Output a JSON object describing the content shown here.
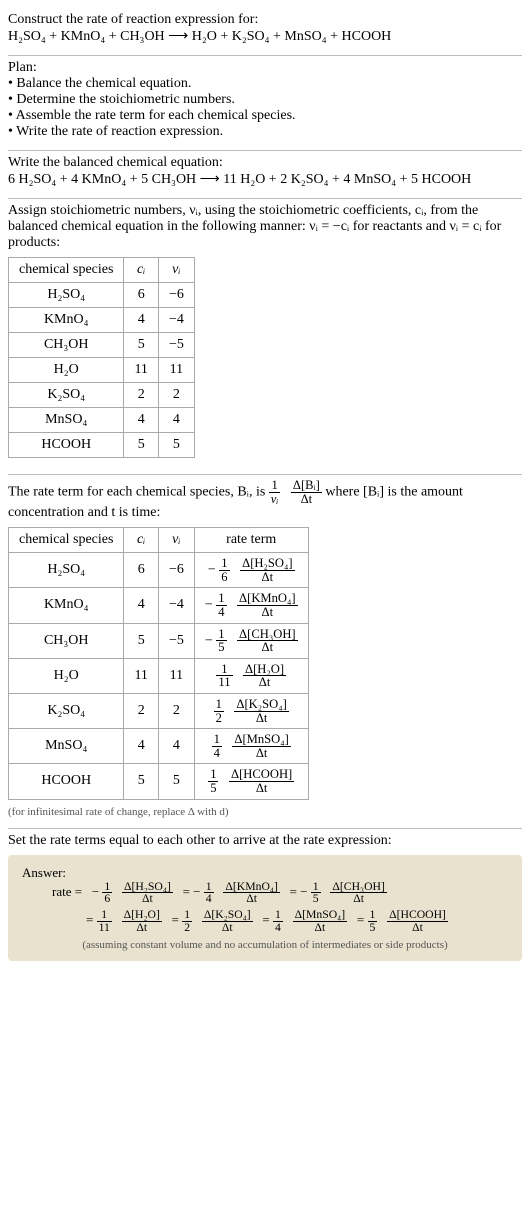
{
  "prompt_title": "Construct the rate of reaction expression for:",
  "main_eq": "H₂SO₄ + KMnO₄ + CH₃OH ⟶ H₂O + K₂SO₄ + MnSO₄ + HCOOH",
  "plan_title": "Plan:",
  "plan_items": [
    "Balance the chemical equation.",
    "Determine the stoichiometric numbers.",
    "Assemble the rate term for each chemical species.",
    "Write the rate of reaction expression."
  ],
  "balanced_title": "Write the balanced chemical equation:",
  "balanced_eq": "6 H₂SO₄ + 4 KMnO₄ + 5 CH₃OH ⟶ 11 H₂O + 2 K₂SO₄ + 4 MnSO₄ + 5 HCOOH",
  "assign_text_a": "Assign stoichiometric numbers, νᵢ, using the stoichiometric coefficients, cᵢ, from the balanced chemical equation in the following manner: νᵢ = −cᵢ for reactants and νᵢ = cᵢ for products:",
  "table1": {
    "headers": [
      "chemical species",
      "cᵢ",
      "νᵢ"
    ],
    "rows": [
      [
        "H₂SO₄",
        "6",
        "−6"
      ],
      [
        "KMnO₄",
        "4",
        "−4"
      ],
      [
        "CH₃OH",
        "5",
        "−5"
      ],
      [
        "H₂O",
        "11",
        "11"
      ],
      [
        "K₂SO₄",
        "2",
        "2"
      ],
      [
        "MnSO₄",
        "4",
        "4"
      ],
      [
        "HCOOH",
        "5",
        "5"
      ]
    ]
  },
  "rate_term_intro_a": "The rate term for each chemical species, Bᵢ, is ",
  "rate_term_intro_b": " where [Bᵢ] is the amount concentration and t is time:",
  "frac1_left_num": "1",
  "frac1_left_den": "νᵢ",
  "frac1_right_num": "Δ[Bᵢ]",
  "frac1_right_den": "Δt",
  "table2": {
    "headers": [
      "chemical species",
      "cᵢ",
      "νᵢ",
      "rate term"
    ],
    "rows": [
      {
        "sp": "H₂SO₄",
        "c": "6",
        "v": "−6",
        "sign": "−",
        "coef_num": "1",
        "coef_den": "6",
        "dnum": "Δ[H₂SO₄]",
        "dden": "Δt"
      },
      {
        "sp": "KMnO₄",
        "c": "4",
        "v": "−4",
        "sign": "−",
        "coef_num": "1",
        "coef_den": "4",
        "dnum": "Δ[KMnO₄]",
        "dden": "Δt"
      },
      {
        "sp": "CH₃OH",
        "c": "5",
        "v": "−5",
        "sign": "−",
        "coef_num": "1",
        "coef_den": "5",
        "dnum": "Δ[CH₃OH]",
        "dden": "Δt"
      },
      {
        "sp": "H₂O",
        "c": "11",
        "v": "11",
        "sign": "",
        "coef_num": "1",
        "coef_den": "11",
        "dnum": "Δ[H₂O]",
        "dden": "Δt"
      },
      {
        "sp": "K₂SO₄",
        "c": "2",
        "v": "2",
        "sign": "",
        "coef_num": "1",
        "coef_den": "2",
        "dnum": "Δ[K₂SO₄]",
        "dden": "Δt"
      },
      {
        "sp": "MnSO₄",
        "c": "4",
        "v": "4",
        "sign": "",
        "coef_num": "1",
        "coef_den": "4",
        "dnum": "Δ[MnSO₄]",
        "dden": "Δt"
      },
      {
        "sp": "HCOOH",
        "c": "5",
        "v": "5",
        "sign": "",
        "coef_num": "1",
        "coef_den": "5",
        "dnum": "Δ[HCOOH]",
        "dden": "Δt"
      }
    ]
  },
  "infinitesimal_note": "(for infinitesimal rate of change, replace Δ with d)",
  "set_equal_text": "Set the rate terms equal to each other to arrive at the rate expression:",
  "answer_label": "Answer:",
  "answer_rate_label": "rate =",
  "answer_terms_line1": [
    {
      "sign": "−",
      "cnum": "1",
      "cden": "6",
      "dnum": "Δ[H₂SO₄]",
      "dden": "Δt"
    },
    {
      "sign": "= −",
      "cnum": "1",
      "cden": "4",
      "dnum": "Δ[KMnO₄]",
      "dden": "Δt"
    },
    {
      "sign": "= −",
      "cnum": "1",
      "cden": "5",
      "dnum": "Δ[CH₃OH]",
      "dden": "Δt"
    }
  ],
  "answer_terms_line2": [
    {
      "sign": "=",
      "cnum": "1",
      "cden": "11",
      "dnum": "Δ[H₂O]",
      "dden": "Δt"
    },
    {
      "sign": "=",
      "cnum": "1",
      "cden": "2",
      "dnum": "Δ[K₂SO₄]",
      "dden": "Δt"
    },
    {
      "sign": "=",
      "cnum": "1",
      "cden": "4",
      "dnum": "Δ[MnSO₄]",
      "dden": "Δt"
    },
    {
      "sign": "=",
      "cnum": "1",
      "cden": "5",
      "dnum": "Δ[HCOOH]",
      "dden": "Δt"
    }
  ],
  "answer_note": "(assuming constant volume and no accumulation of intermediates or side products)",
  "chart_data": {
    "type": "table",
    "title": "Stoichiometric coefficients and rate terms",
    "species": [
      "H2SO4",
      "KMnO4",
      "CH3OH",
      "H2O",
      "K2SO4",
      "MnSO4",
      "HCOOH"
    ],
    "c_i": [
      6,
      4,
      5,
      11,
      2,
      4,
      5
    ],
    "nu_i": [
      -6,
      -4,
      -5,
      11,
      2,
      4,
      5
    ],
    "rate_term_coefficient": [
      "-1/6",
      "-1/4",
      "-1/5",
      "1/11",
      "1/2",
      "1/4",
      "1/5"
    ]
  }
}
